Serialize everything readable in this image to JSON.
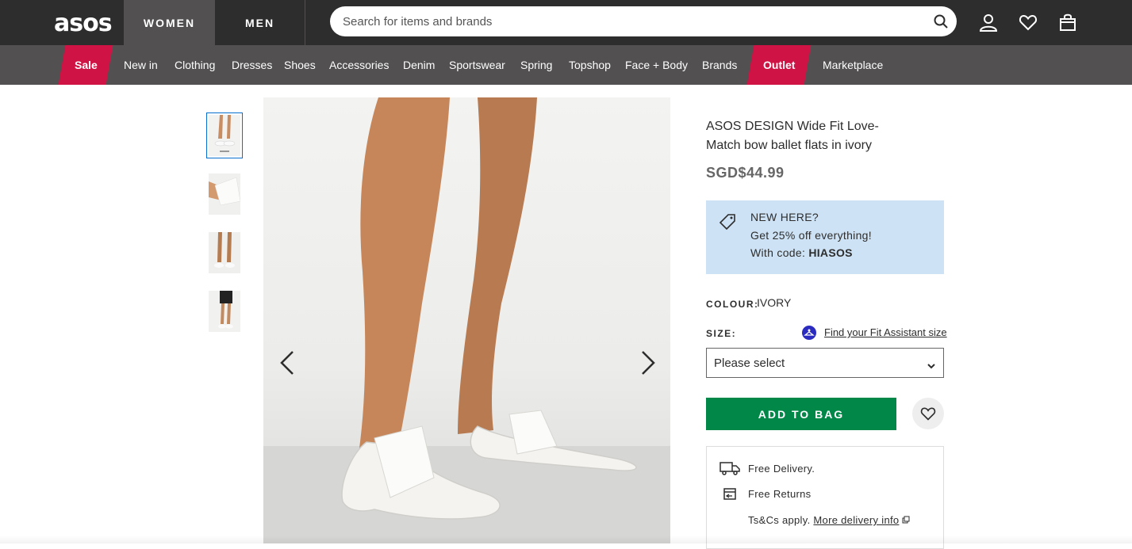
{
  "header": {
    "logo": "asos",
    "tabs": [
      "WOMEN",
      "MEN"
    ],
    "search_placeholder": "Search for items and brands",
    "icons": [
      "account-icon",
      "heart-icon",
      "bag-icon"
    ]
  },
  "nav": {
    "sale": "Sale",
    "items": [
      "New in",
      "Clothing",
      "Dresses",
      "Shoes",
      "Accessories",
      "Denim",
      "Sportswear",
      "Spring",
      "Topshop",
      "Face + Body",
      "Brands"
    ],
    "outlet": "Outlet",
    "marketplace": "Marketplace",
    "accent_color": "#d01345"
  },
  "product": {
    "title": "ASOS DESIGN Wide Fit Love-Match bow ballet flats in ivory",
    "price": "SGD$44.99",
    "promo": {
      "line1": "NEW HERE?",
      "line2": "Get 25% off everything!",
      "line3_prefix": "With code: ",
      "code": "HIASOS"
    },
    "colour_label": "COLOUR:",
    "colour_value": "IVORY",
    "size_label": "SIZE:",
    "fit_link": "Find your Fit Assistant size",
    "size_select": "Please select",
    "add_to_bag": "ADD TO BAG",
    "delivery": {
      "free_delivery": "Free Delivery.",
      "free_returns": "Free Returns",
      "tcs": "Ts&Cs apply. ",
      "more_info": "More delivery info"
    }
  },
  "colors": {
    "header_bg": "#2d2d2d",
    "nav_bg": "#525050",
    "promo_bg": "#cde2f5",
    "add_to_bag_bg": "#018849"
  }
}
